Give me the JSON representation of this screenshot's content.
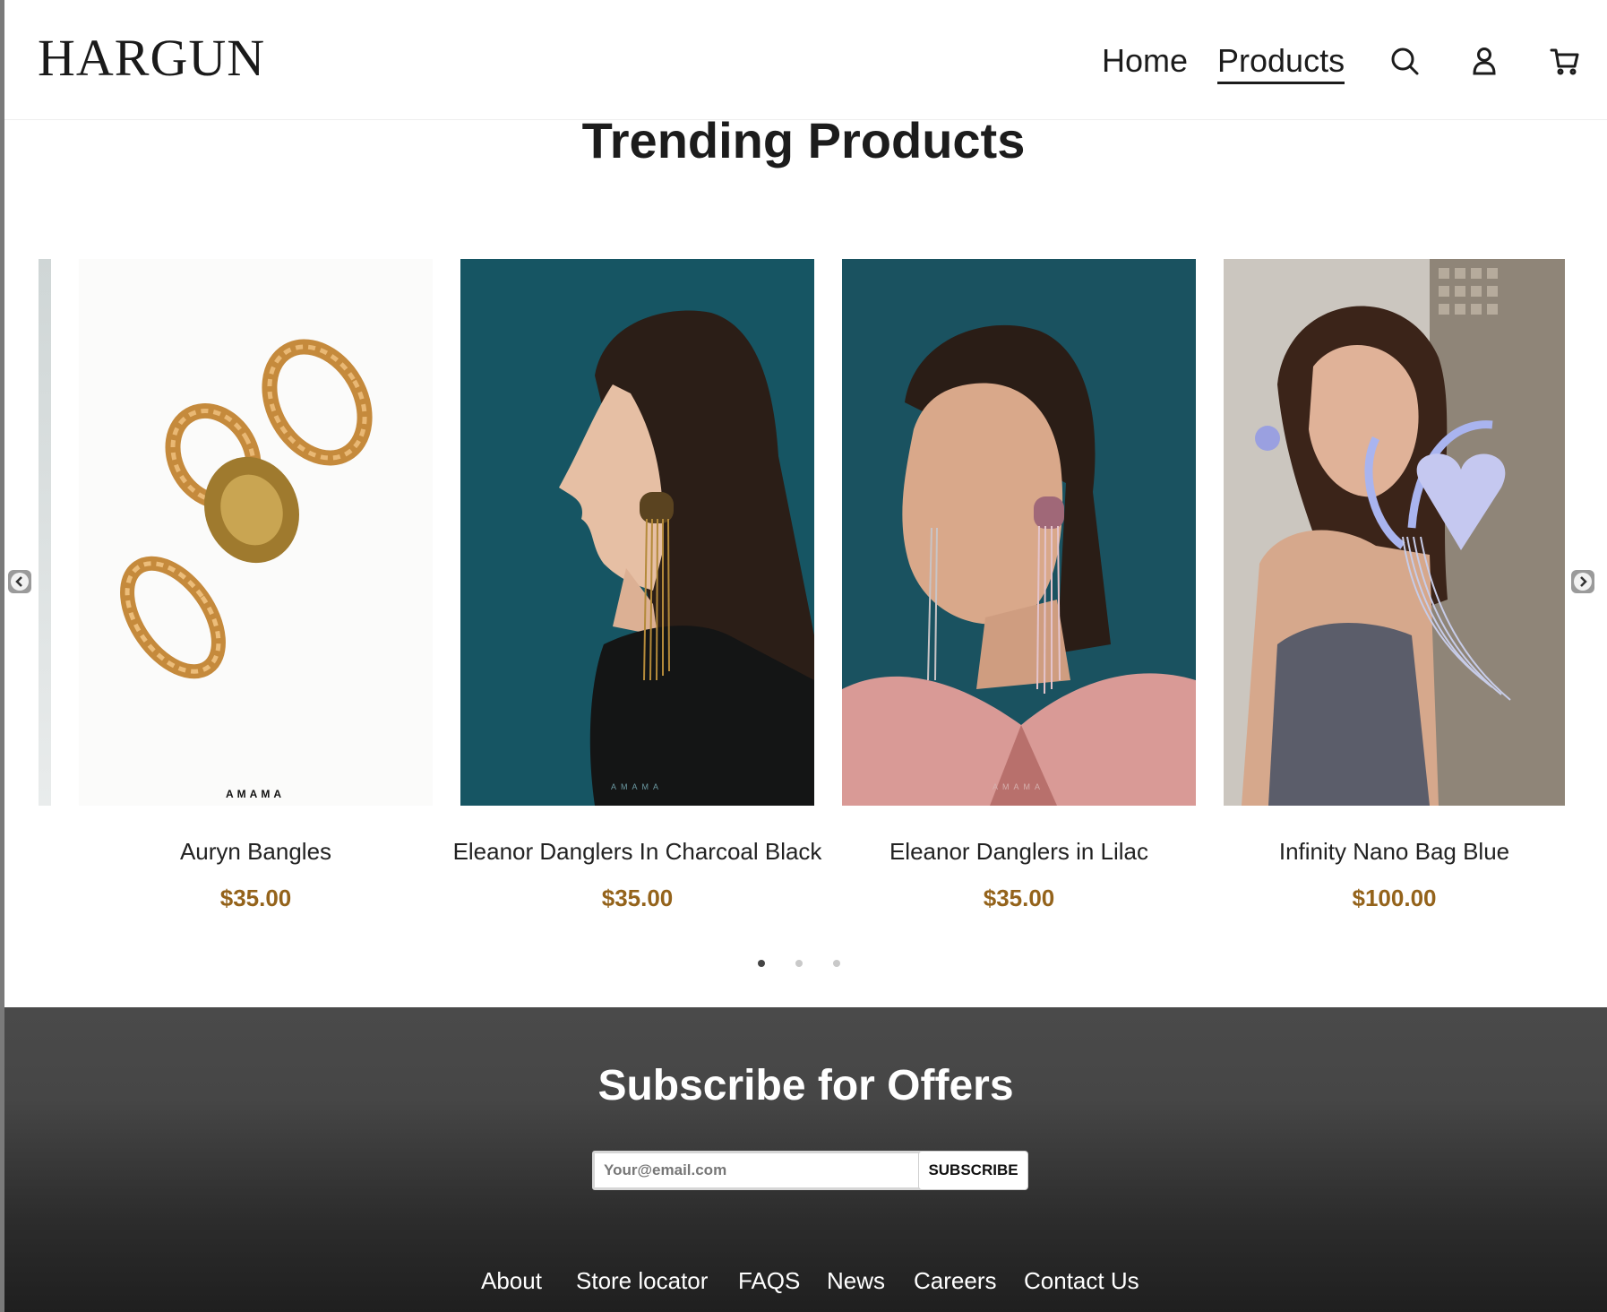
{
  "header": {
    "logo": "HARGUN",
    "nav": [
      {
        "label": "Home",
        "active": false
      },
      {
        "label": "Products",
        "active": true
      }
    ],
    "icons": [
      "search-icon",
      "account-icon",
      "cart-icon"
    ]
  },
  "trending": {
    "title": "Trending Products",
    "products": [
      {
        "name": "Auryn Bangles",
        "price": "$35.00",
        "image_label": "AMAMA"
      },
      {
        "name": "Eleanor Danglers In Charcoal Black",
        "price": "$35.00",
        "image_label": "AMAMA"
      },
      {
        "name": "Eleanor Danglers in Lilac",
        "price": "$35.00",
        "image_label": "AMAMA"
      },
      {
        "name": "Infinity Nano Bag Blue",
        "price": "$100.00",
        "image_label": ""
      }
    ],
    "pagination": {
      "pages": 3,
      "current": 1
    }
  },
  "subscribe": {
    "title": "Subscribe for Offers",
    "email_placeholder": "Your@email.com",
    "button_label": "SUBSCRIBE"
  },
  "footer_links": [
    "About",
    "Store locator",
    "FAQS",
    "News",
    "Careers",
    "Contact Us"
  ],
  "colors": {
    "price": "#94631b",
    "footer_bg": "#464646",
    "text": "#1c1c1c"
  }
}
